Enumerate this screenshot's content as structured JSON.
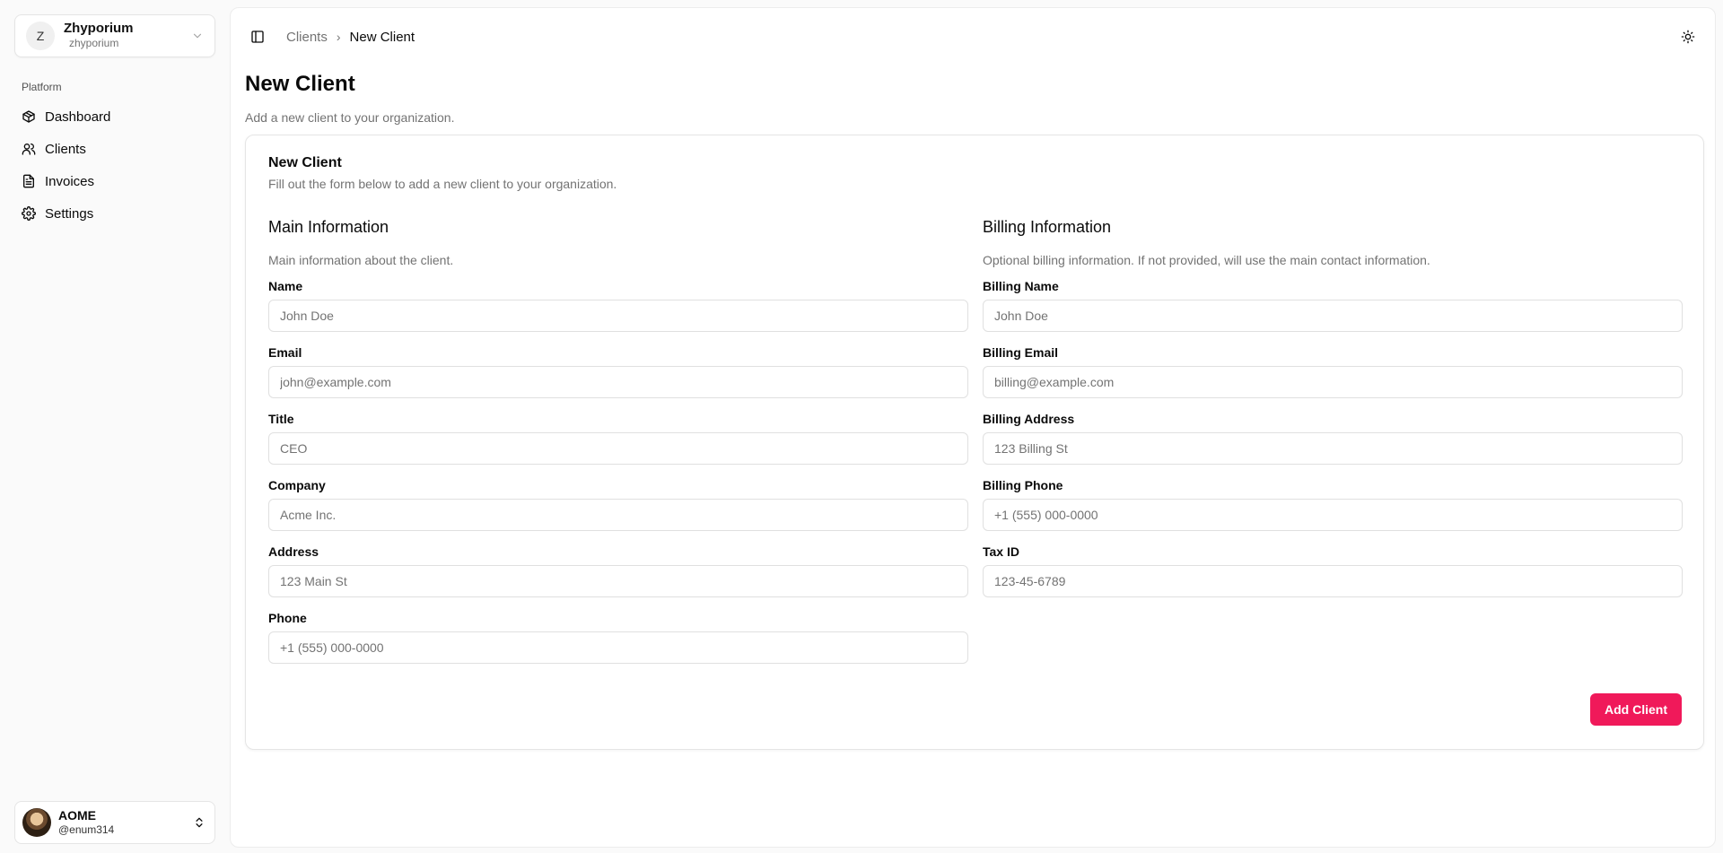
{
  "org": {
    "initial": "Z",
    "name": "Zhyporium",
    "slug": "zhyporium"
  },
  "nav": {
    "group_label": "Platform",
    "items": [
      {
        "label": "Dashboard",
        "icon": "box-icon"
      },
      {
        "label": "Clients",
        "icon": "users-icon"
      },
      {
        "label": "Invoices",
        "icon": "file-text-icon"
      },
      {
        "label": "Settings",
        "icon": "gear-icon"
      }
    ]
  },
  "user": {
    "name": "AOME",
    "handle": "@enum314"
  },
  "breadcrumb": {
    "parent": "Clients",
    "separator": "›",
    "current": "New Client"
  },
  "page": {
    "title": "New Client",
    "subtitle": "Add a new client to your organization."
  },
  "card": {
    "title": "New Client",
    "description": "Fill out the form below to add a new client to your organization."
  },
  "main_info": {
    "title": "Main Information",
    "description": "Main information about the client.",
    "fields": [
      {
        "label": "Name",
        "placeholder": "John Doe"
      },
      {
        "label": "Email",
        "placeholder": "john@example.com"
      },
      {
        "label": "Title",
        "placeholder": "CEO"
      },
      {
        "label": "Company",
        "placeholder": "Acme Inc."
      },
      {
        "label": "Address",
        "placeholder": "123 Main St"
      },
      {
        "label": "Phone",
        "placeholder": "+1 (555) 000-0000"
      }
    ]
  },
  "billing_info": {
    "title": "Billing Information",
    "description": "Optional billing information. If not provided, will use the main contact information.",
    "fields": [
      {
        "label": "Billing Name",
        "placeholder": "John Doe"
      },
      {
        "label": "Billing Email",
        "placeholder": "billing@example.com"
      },
      {
        "label": "Billing Address",
        "placeholder": "123 Billing St"
      },
      {
        "label": "Billing Phone",
        "placeholder": "+1 (555) 000-0000"
      },
      {
        "label": "Tax ID",
        "placeholder": "123-45-6789"
      }
    ]
  },
  "actions": {
    "submit_label": "Add Client",
    "accent_color": "#f0195a"
  }
}
